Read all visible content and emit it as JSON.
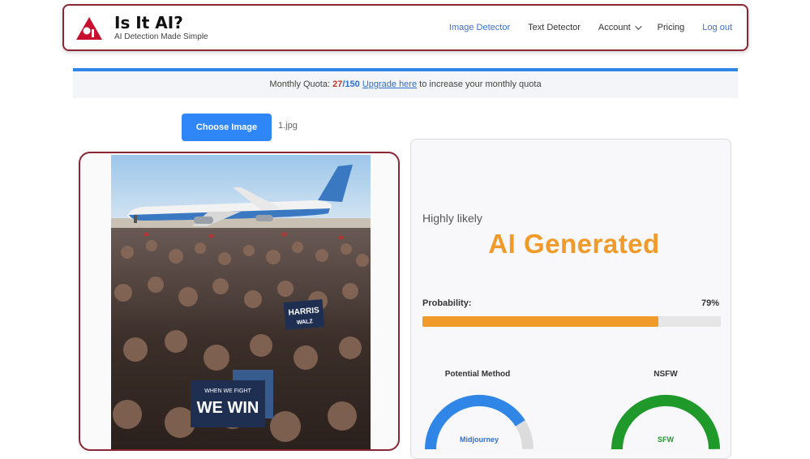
{
  "brand": {
    "title": "Is It AI?",
    "subtitle": "AI Detection Made Simple",
    "logo_icon": "red-triangle-a-logo",
    "color": "#c8102e"
  },
  "nav": {
    "items": [
      {
        "label": "Image Detector",
        "active": true
      },
      {
        "label": "Text Detector",
        "active": false
      },
      {
        "label": "Account",
        "active": false
      },
      {
        "label": "Pricing",
        "active": false
      },
      {
        "label": "Log out",
        "active": true
      }
    ]
  },
  "quota": {
    "prefix": "Monthly Quota: ",
    "used": "27",
    "slash": "/",
    "total": "150",
    "link_text": "Upgrade here",
    "suffix": " to increase your monthly quota"
  },
  "upload": {
    "button_label": "Choose Image",
    "file_name": "1.jpg"
  },
  "photo": {
    "sign1_line1": "HARRIS",
    "sign1_line2": "WALZ",
    "sign2_line1": "WHEN WE FIGHT",
    "sign2_line2": "WE WIN"
  },
  "result": {
    "likelihood": "Highly likely",
    "verdict": "AI Generated",
    "probability_label": "Probability:",
    "probability_text": "79%",
    "probability_value": 79,
    "accent_color": "#f09a2a"
  },
  "gauges": [
    {
      "title": "Potential Method",
      "value_label": "Midjourney",
      "color": "#2f86e6",
      "level": 0.82
    },
    {
      "title": "NSFW",
      "value_label": "SFW",
      "color": "#1f9a2a",
      "level": 1.0
    }
  ]
}
